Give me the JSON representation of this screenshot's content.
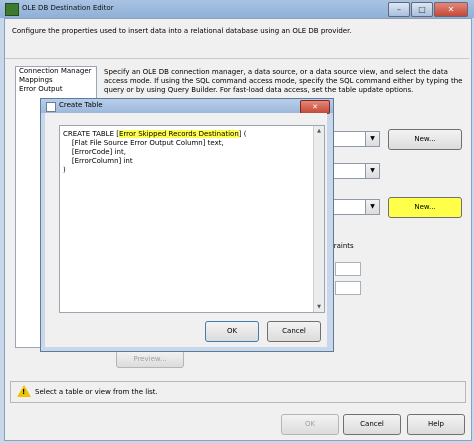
{
  "window": {
    "title": "OLE DB Destination Editor"
  },
  "description": "Configure the properties used to insert data into a relational database using an OLE DB provider.",
  "nav": {
    "items": [
      "Connection Manager",
      "Mappings",
      "Error Output"
    ]
  },
  "right_text": "Specify an OLE DB connection manager, a data source, or a data source view, and select the data access mode. If using the SQL command access mode, specify the SQL command either by typing the query or by using Query Builder. For fast-load data access, set the table update options.",
  "buttons": {
    "new1": "New...",
    "new2": "New...",
    "preview": "Preview...",
    "ok": "OK",
    "cancel": "Cancel",
    "help": "Help"
  },
  "partial_label": "traints",
  "message": "Select a table or view from the list.",
  "dialog": {
    "title": "Create Table",
    "sql_prefix": "CREATE TABLE [",
    "sql_highlight": "Error Skipped Records Destination",
    "sql_suffix": "] (",
    "sql_lines": [
      "    [Flat File Source Error Output Column] text,",
      "    [ErrorCode] int,",
      "    [ErrorColumn] int",
      ")"
    ],
    "ok": "OK",
    "cancel": "Cancel"
  },
  "colors": {
    "highlight": "#ffff4a",
    "titlebar": "#9cb8dc"
  }
}
